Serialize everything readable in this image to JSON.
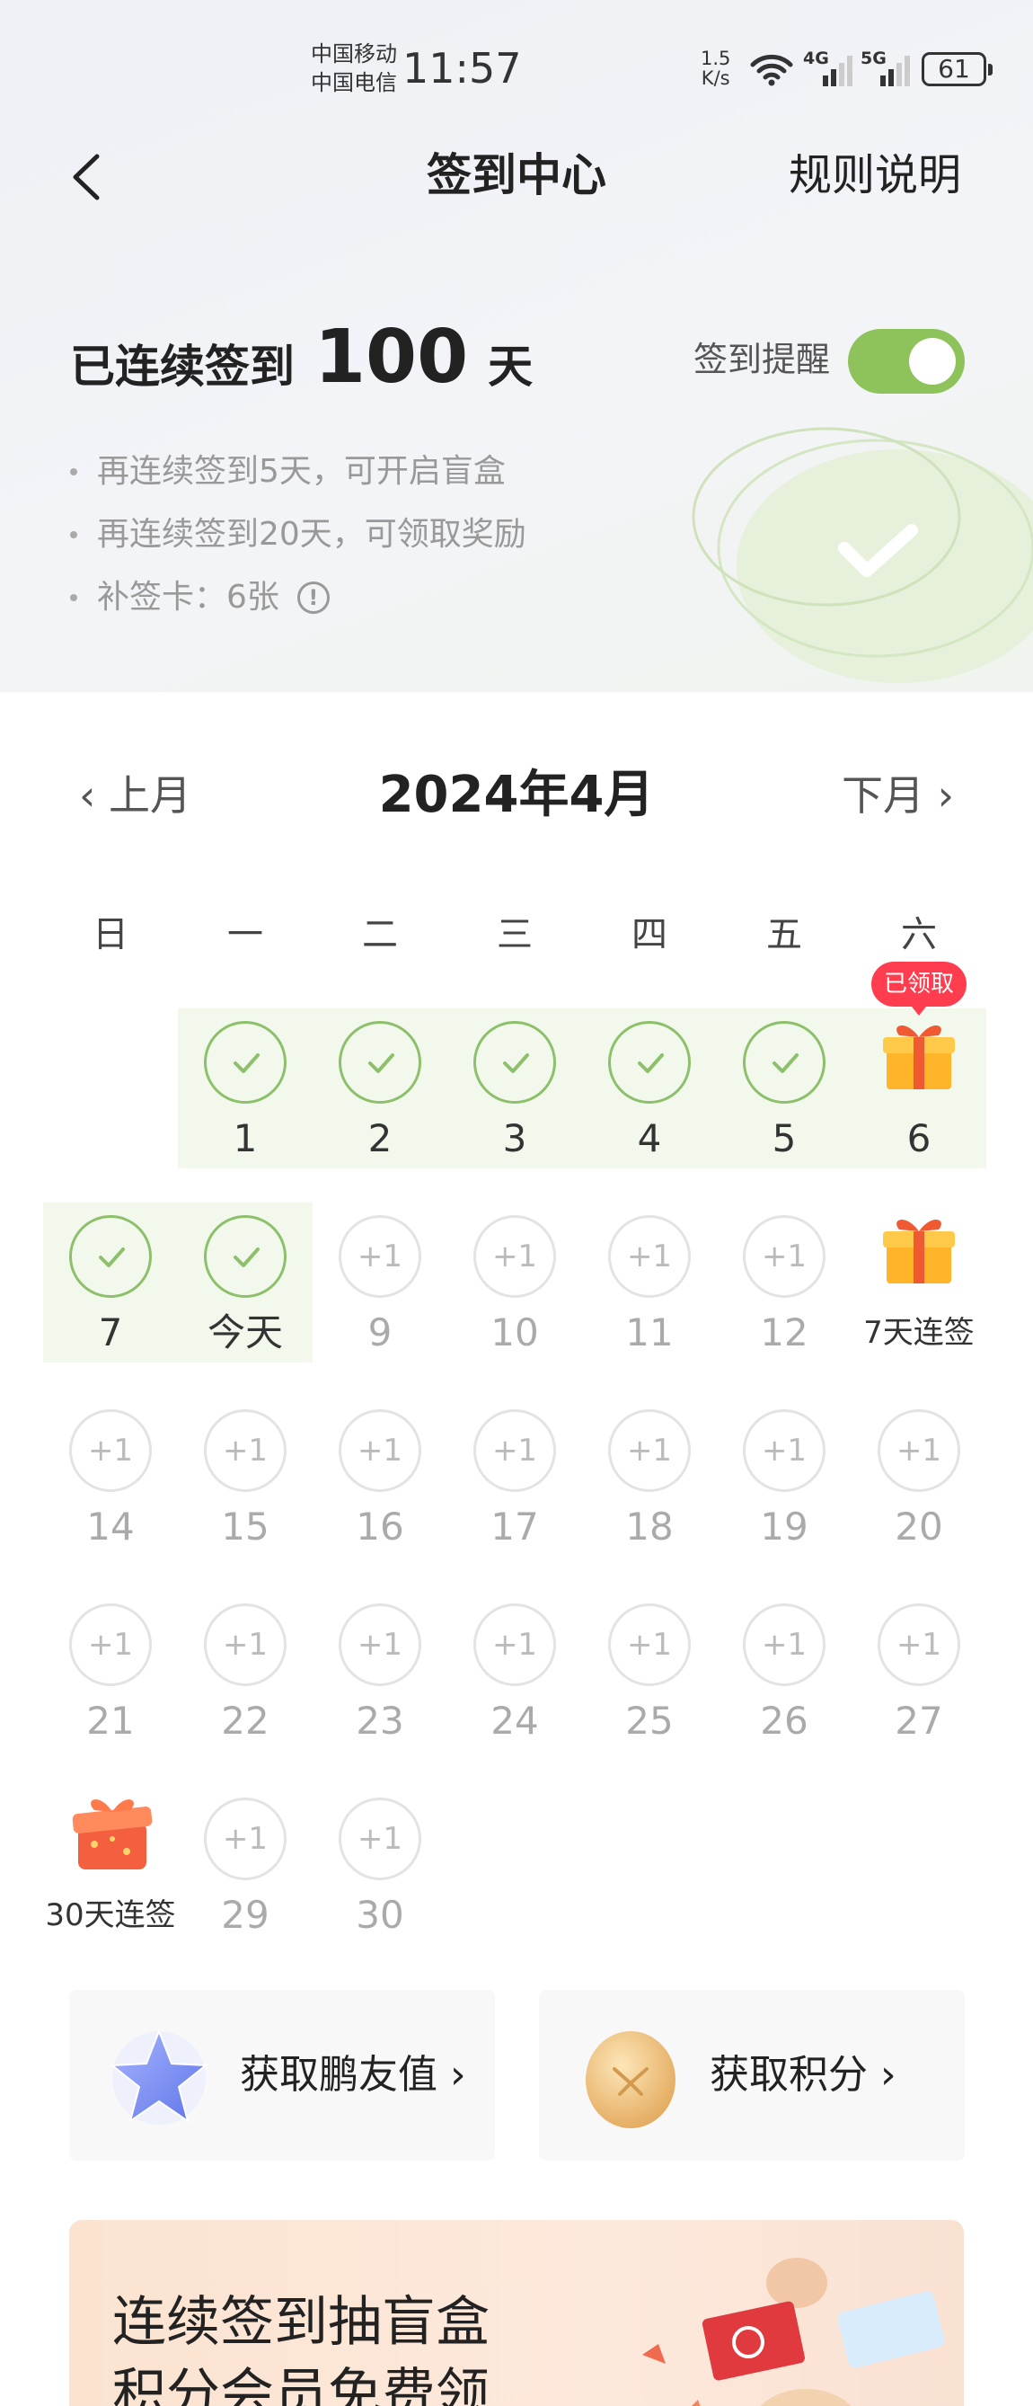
{
  "status_bar": {
    "carrier1": "中国移动",
    "carrier2": "中国电信",
    "time": "11:57",
    "net_speed_value": "1.5",
    "net_speed_unit": "K/s",
    "sim1_type": "4G",
    "sim2_type": "5G",
    "battery": "61"
  },
  "navbar": {
    "title": "签到中心",
    "rules_label": "规则说明"
  },
  "streak": {
    "prefix": "已连续签到",
    "days": "100",
    "suffix": "天",
    "reminder_label": "签到提醒",
    "reminder_on": true
  },
  "tips": [
    "再连续签到5天，可开启盲盒",
    "再连续签到20天，可领取奖励",
    "补签卡：6张"
  ],
  "calendar": {
    "prev_label": "上月",
    "next_label": "下月",
    "month_title": "2024年4月",
    "weekdays": [
      "日",
      "一",
      "二",
      "三",
      "四",
      "五",
      "六"
    ],
    "plus_label": "+1",
    "claimed_badge": "已领取",
    "weeks": [
      [
        null,
        {
          "label": "1",
          "state": "done"
        },
        {
          "label": "2",
          "state": "done"
        },
        {
          "label": "3",
          "state": "done"
        },
        {
          "label": "4",
          "state": "done"
        },
        {
          "label": "5",
          "state": "done"
        },
        {
          "label": "6",
          "state": "gift-claimed"
        }
      ],
      [
        {
          "label": "7",
          "state": "done"
        },
        {
          "label": "今天",
          "state": "done"
        },
        {
          "label": "9",
          "state": "future"
        },
        {
          "label": "10",
          "state": "future"
        },
        {
          "label": "11",
          "state": "future"
        },
        {
          "label": "12",
          "state": "future"
        },
        {
          "label": "7天连签",
          "state": "gift"
        }
      ],
      [
        {
          "label": "14",
          "state": "future"
        },
        {
          "label": "15",
          "state": "future"
        },
        {
          "label": "16",
          "state": "future"
        },
        {
          "label": "17",
          "state": "future"
        },
        {
          "label": "18",
          "state": "future"
        },
        {
          "label": "19",
          "state": "future"
        },
        {
          "label": "20",
          "state": "future"
        }
      ],
      [
        {
          "label": "21",
          "state": "future"
        },
        {
          "label": "22",
          "state": "future"
        },
        {
          "label": "23",
          "state": "future"
        },
        {
          "label": "24",
          "state": "future"
        },
        {
          "label": "25",
          "state": "future"
        },
        {
          "label": "26",
          "state": "future"
        },
        {
          "label": "27",
          "state": "future"
        }
      ],
      [
        {
          "label": "30天连签",
          "state": "big-gift"
        },
        {
          "label": "29",
          "state": "future"
        },
        {
          "label": "30",
          "state": "future"
        },
        null,
        null,
        null,
        null
      ]
    ]
  },
  "actions": {
    "friend_value_label": "获取鹏友值",
    "points_label": "获取积分"
  },
  "banner": {
    "line1": "连续签到抽盲盒",
    "line2": "积分会员免费领"
  },
  "colors": {
    "toggle_on": "#8ec25a",
    "checked_ring": "#8dc06a",
    "claimed_badge": "#ff3d4f",
    "signed_band": "#f3f8ec"
  }
}
